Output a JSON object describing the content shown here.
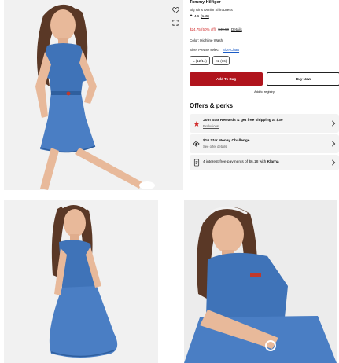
{
  "product": {
    "brand": "Tommy Hilfiger",
    "name": "Big Girls Denim Shirt Dress",
    "rating_star": "★",
    "rating_value": "4.6",
    "rating_count": "(145)",
    "price_sale": "$24.75 (50% off)",
    "price_original": "$49.50",
    "details_link": "Details",
    "color_label": "Color: Highline Wash",
    "size_label": "Size: Please select",
    "size_chart": "Size Chart",
    "sizes": [
      "L (12/14)",
      "XL (16)"
    ],
    "add_to_bag": "Add To Bag",
    "buy_now": "Buy Now",
    "registry": "Add to registry"
  },
  "offers": {
    "title": "Offers & perks",
    "items": [
      {
        "title": "Join Star Rewards & get free shipping at $39",
        "subtitle": "Exclusions",
        "icon": "star-icon"
      },
      {
        "title": "$10 Star Money Challenge",
        "subtitle": "See offer details",
        "icon": "star-money-icon"
      },
      {
        "title": "4 interest-free payments of $6.18 with",
        "brand": "Klarna",
        "icon": "document-icon"
      }
    ]
  },
  "gallery": {
    "icons": [
      "heart-icon",
      "expand-icon"
    ]
  },
  "colors": {
    "accent_red": "#b0141d",
    "denim": "#3f73b8",
    "panel": "#f3f3f3"
  }
}
